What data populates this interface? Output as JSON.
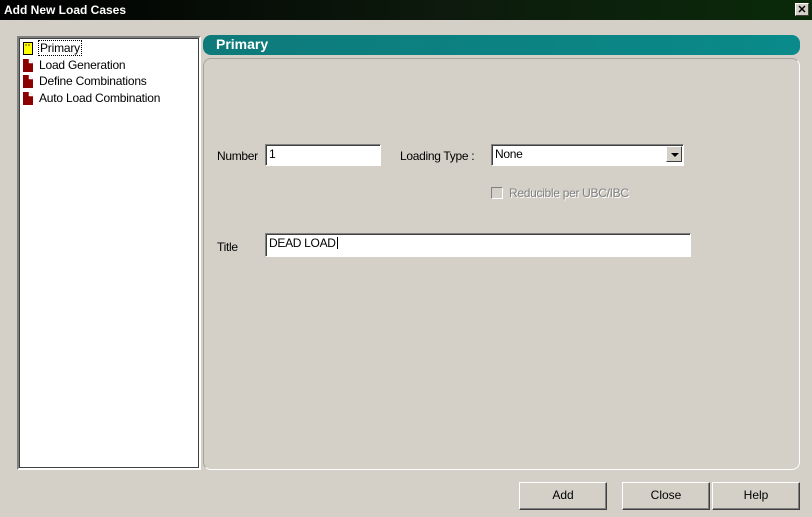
{
  "window": {
    "title": "Add New Load Cases",
    "close_glyph": "✕"
  },
  "tree": {
    "items": [
      {
        "label": "Primary",
        "icon": "primary-load-icon",
        "selected": true
      },
      {
        "label": "Load Generation",
        "icon": "page-icon"
      },
      {
        "label": "Define Combinations",
        "icon": "page-icon"
      },
      {
        "label": "Auto Load Combination",
        "icon": "page-icon"
      }
    ]
  },
  "panel": {
    "header": "Primary",
    "number_label": "Number",
    "number_value": "1",
    "loading_type_label": "Loading Type :",
    "loading_type_value": "None",
    "reducible_label": "Reducible per UBC/IBC",
    "reducible_checked": false,
    "reducible_enabled": false,
    "title_label": "Title",
    "title_value": "DEAD LOAD"
  },
  "buttons": {
    "add": "Add",
    "close": "Close",
    "help": "Help"
  },
  "colors": {
    "header_accent": "#0e7a7a",
    "dialog_bg": "#d4d0c8",
    "icon_red": "#8b0000",
    "icon_yellow": "#ffff00"
  }
}
